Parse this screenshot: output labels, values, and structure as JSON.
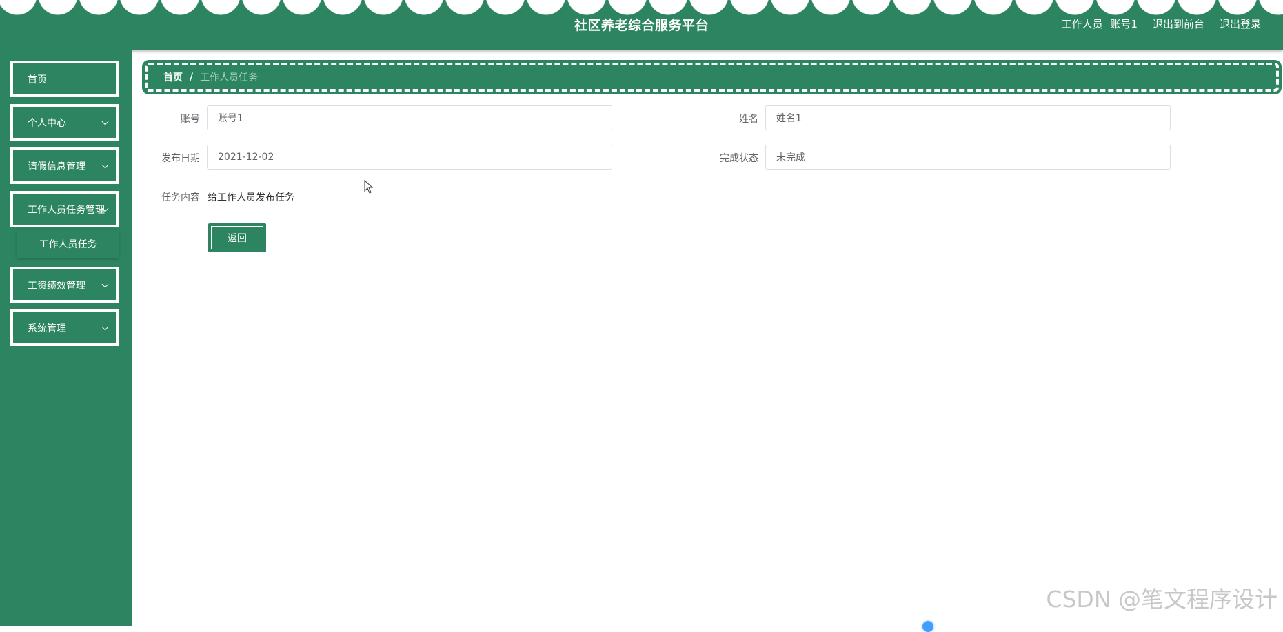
{
  "header": {
    "title": "社区养老综合服务平台",
    "user_role": "工作人员",
    "user_account": "账号1",
    "to_frontend_label": "退出到前台",
    "logout_label": "退出登录"
  },
  "sidebar": {
    "items": [
      {
        "label": "首页"
      },
      {
        "label": "个人中心"
      },
      {
        "label": "请假信息管理"
      },
      {
        "label": "工作人员任务管理"
      },
      {
        "label": "工资绩效管理"
      },
      {
        "label": "系统管理"
      }
    ],
    "sub_items": [
      {
        "label": "工作人员任务"
      }
    ]
  },
  "breadcrumb": {
    "home": "首页",
    "separator": "/",
    "current": "工作人员任务"
  },
  "form": {
    "account": {
      "label": "账号",
      "value": "账号1"
    },
    "name": {
      "label": "姓名",
      "value": "姓名1"
    },
    "publish_date": {
      "label": "发布日期",
      "value": "2021-12-02"
    },
    "status": {
      "label": "完成状态",
      "value": "未完成"
    },
    "task_content": {
      "label": "任务内容",
      "value": "给工作人员发布任务"
    },
    "back_button": "返回"
  },
  "watermark": "CSDN @笔文程序设计",
  "colors": {
    "primary": "#2c8560",
    "text_label": "#606266",
    "border": "#dcdfe6"
  }
}
